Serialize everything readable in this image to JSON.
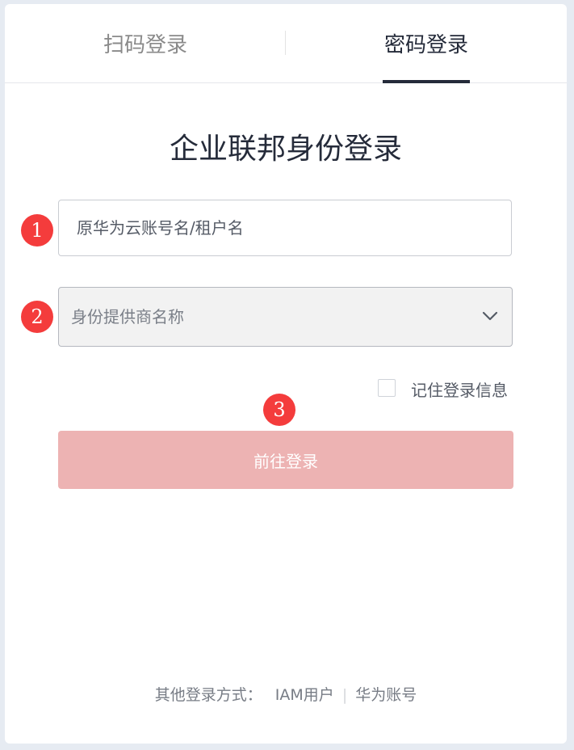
{
  "tabs": {
    "qr_label": "扫码登录",
    "password_label": "密码登录",
    "active": "password"
  },
  "title": "企业联邦身份登录",
  "form": {
    "account_placeholder": "原华为云账号名/租户名",
    "account_value": "",
    "idp_placeholder": "身份提供商名称",
    "remember_label": "记住登录信息",
    "remember_checked": false,
    "submit_label": "前往登录"
  },
  "markers": [
    "1",
    "2",
    "3"
  ],
  "footer": {
    "prefix": "其他登录方式：",
    "iam_link": "IAM用户",
    "separator": "|",
    "huawei_link": "华为账号"
  },
  "colors": {
    "marker": "#f43c3c",
    "submit_disabled": "#edb3b3",
    "text_dark": "#252b3a",
    "tab_active_underline": "#252b3a"
  },
  "icons": {
    "select_chevron": "chevron-down-icon"
  }
}
